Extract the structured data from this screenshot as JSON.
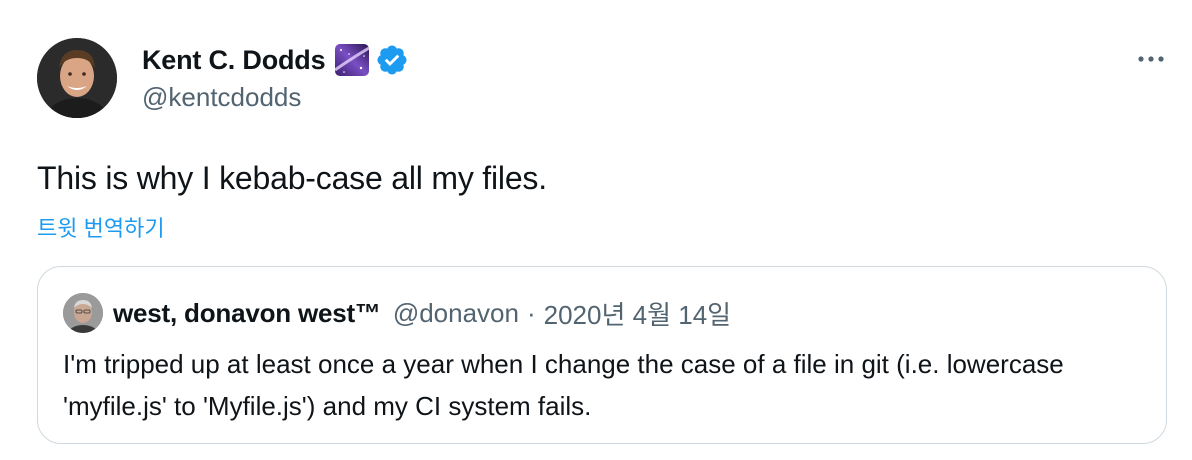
{
  "tweet": {
    "author": {
      "display_name": "Kent C. Dodds",
      "handle": "@kentcdodds",
      "emoji_badge": "milky-way-emoji",
      "verified": true
    },
    "text": "This is why I kebab-case all my files.",
    "translate_label": "트윗 번역하기",
    "more_icon": "more-horizontal-icon"
  },
  "quote": {
    "author": {
      "display_name": "west, donavon west™",
      "handle": "@donavon",
      "separator": "·"
    },
    "date": "2020년 4월 14일",
    "text": "I'm tripped up at least once a year when I change the case of a file in git (i.e. lowercase 'myfile.js' to 'Myfile.js') and my CI system fails."
  },
  "colors": {
    "text_primary": "#0f1419",
    "text_secondary": "#536471",
    "accent": "#1d9bf0",
    "border": "#cfd9de",
    "verified": "#1d9bf0"
  }
}
